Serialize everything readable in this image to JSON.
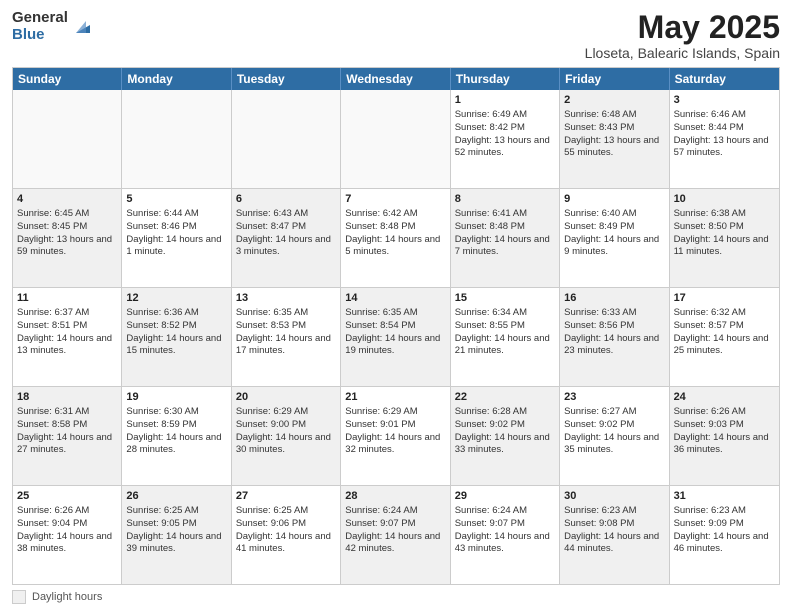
{
  "logo": {
    "general": "General",
    "blue": "Blue",
    "icon_color": "#2e6da4"
  },
  "title": "May 2025",
  "location": "Lloseta, Balearic Islands, Spain",
  "days_of_week": [
    "Sunday",
    "Monday",
    "Tuesday",
    "Wednesday",
    "Thursday",
    "Friday",
    "Saturday"
  ],
  "weeks": [
    [
      {
        "day": "",
        "sunrise": "",
        "sunset": "",
        "daylight": "",
        "shaded": false,
        "empty": true
      },
      {
        "day": "",
        "sunrise": "",
        "sunset": "",
        "daylight": "",
        "shaded": false,
        "empty": true
      },
      {
        "day": "",
        "sunrise": "",
        "sunset": "",
        "daylight": "",
        "shaded": false,
        "empty": true
      },
      {
        "day": "",
        "sunrise": "",
        "sunset": "",
        "daylight": "",
        "shaded": false,
        "empty": true
      },
      {
        "day": "1",
        "sunrise": "Sunrise: 6:49 AM",
        "sunset": "Sunset: 8:42 PM",
        "daylight": "Daylight: 13 hours and 52 minutes.",
        "shaded": false,
        "empty": false
      },
      {
        "day": "2",
        "sunrise": "Sunrise: 6:48 AM",
        "sunset": "Sunset: 8:43 PM",
        "daylight": "Daylight: 13 hours and 55 minutes.",
        "shaded": true,
        "empty": false
      },
      {
        "day": "3",
        "sunrise": "Sunrise: 6:46 AM",
        "sunset": "Sunset: 8:44 PM",
        "daylight": "Daylight: 13 hours and 57 minutes.",
        "shaded": false,
        "empty": false
      }
    ],
    [
      {
        "day": "4",
        "sunrise": "Sunrise: 6:45 AM",
        "sunset": "Sunset: 8:45 PM",
        "daylight": "Daylight: 13 hours and 59 minutes.",
        "shaded": true,
        "empty": false
      },
      {
        "day": "5",
        "sunrise": "Sunrise: 6:44 AM",
        "sunset": "Sunset: 8:46 PM",
        "daylight": "Daylight: 14 hours and 1 minute.",
        "shaded": false,
        "empty": false
      },
      {
        "day": "6",
        "sunrise": "Sunrise: 6:43 AM",
        "sunset": "Sunset: 8:47 PM",
        "daylight": "Daylight: 14 hours and 3 minutes.",
        "shaded": true,
        "empty": false
      },
      {
        "day": "7",
        "sunrise": "Sunrise: 6:42 AM",
        "sunset": "Sunset: 8:48 PM",
        "daylight": "Daylight: 14 hours and 5 minutes.",
        "shaded": false,
        "empty": false
      },
      {
        "day": "8",
        "sunrise": "Sunrise: 6:41 AM",
        "sunset": "Sunset: 8:48 PM",
        "daylight": "Daylight: 14 hours and 7 minutes.",
        "shaded": true,
        "empty": false
      },
      {
        "day": "9",
        "sunrise": "Sunrise: 6:40 AM",
        "sunset": "Sunset: 8:49 PM",
        "daylight": "Daylight: 14 hours and 9 minutes.",
        "shaded": false,
        "empty": false
      },
      {
        "day": "10",
        "sunrise": "Sunrise: 6:38 AM",
        "sunset": "Sunset: 8:50 PM",
        "daylight": "Daylight: 14 hours and 11 minutes.",
        "shaded": true,
        "empty": false
      }
    ],
    [
      {
        "day": "11",
        "sunrise": "Sunrise: 6:37 AM",
        "sunset": "Sunset: 8:51 PM",
        "daylight": "Daylight: 14 hours and 13 minutes.",
        "shaded": false,
        "empty": false
      },
      {
        "day": "12",
        "sunrise": "Sunrise: 6:36 AM",
        "sunset": "Sunset: 8:52 PM",
        "daylight": "Daylight: 14 hours and 15 minutes.",
        "shaded": true,
        "empty": false
      },
      {
        "day": "13",
        "sunrise": "Sunrise: 6:35 AM",
        "sunset": "Sunset: 8:53 PM",
        "daylight": "Daylight: 14 hours and 17 minutes.",
        "shaded": false,
        "empty": false
      },
      {
        "day": "14",
        "sunrise": "Sunrise: 6:35 AM",
        "sunset": "Sunset: 8:54 PM",
        "daylight": "Daylight: 14 hours and 19 minutes.",
        "shaded": true,
        "empty": false
      },
      {
        "day": "15",
        "sunrise": "Sunrise: 6:34 AM",
        "sunset": "Sunset: 8:55 PM",
        "daylight": "Daylight: 14 hours and 21 minutes.",
        "shaded": false,
        "empty": false
      },
      {
        "day": "16",
        "sunrise": "Sunrise: 6:33 AM",
        "sunset": "Sunset: 8:56 PM",
        "daylight": "Daylight: 14 hours and 23 minutes.",
        "shaded": true,
        "empty": false
      },
      {
        "day": "17",
        "sunrise": "Sunrise: 6:32 AM",
        "sunset": "Sunset: 8:57 PM",
        "daylight": "Daylight: 14 hours and 25 minutes.",
        "shaded": false,
        "empty": false
      }
    ],
    [
      {
        "day": "18",
        "sunrise": "Sunrise: 6:31 AM",
        "sunset": "Sunset: 8:58 PM",
        "daylight": "Daylight: 14 hours and 27 minutes.",
        "shaded": true,
        "empty": false
      },
      {
        "day": "19",
        "sunrise": "Sunrise: 6:30 AM",
        "sunset": "Sunset: 8:59 PM",
        "daylight": "Daylight: 14 hours and 28 minutes.",
        "shaded": false,
        "empty": false
      },
      {
        "day": "20",
        "sunrise": "Sunrise: 6:29 AM",
        "sunset": "Sunset: 9:00 PM",
        "daylight": "Daylight: 14 hours and 30 minutes.",
        "shaded": true,
        "empty": false
      },
      {
        "day": "21",
        "sunrise": "Sunrise: 6:29 AM",
        "sunset": "Sunset: 9:01 PM",
        "daylight": "Daylight: 14 hours and 32 minutes.",
        "shaded": false,
        "empty": false
      },
      {
        "day": "22",
        "sunrise": "Sunrise: 6:28 AM",
        "sunset": "Sunset: 9:02 PM",
        "daylight": "Daylight: 14 hours and 33 minutes.",
        "shaded": true,
        "empty": false
      },
      {
        "day": "23",
        "sunrise": "Sunrise: 6:27 AM",
        "sunset": "Sunset: 9:02 PM",
        "daylight": "Daylight: 14 hours and 35 minutes.",
        "shaded": false,
        "empty": false
      },
      {
        "day": "24",
        "sunrise": "Sunrise: 6:26 AM",
        "sunset": "Sunset: 9:03 PM",
        "daylight": "Daylight: 14 hours and 36 minutes.",
        "shaded": true,
        "empty": false
      }
    ],
    [
      {
        "day": "25",
        "sunrise": "Sunrise: 6:26 AM",
        "sunset": "Sunset: 9:04 PM",
        "daylight": "Daylight: 14 hours and 38 minutes.",
        "shaded": false,
        "empty": false
      },
      {
        "day": "26",
        "sunrise": "Sunrise: 6:25 AM",
        "sunset": "Sunset: 9:05 PM",
        "daylight": "Daylight: 14 hours and 39 minutes.",
        "shaded": true,
        "empty": false
      },
      {
        "day": "27",
        "sunrise": "Sunrise: 6:25 AM",
        "sunset": "Sunset: 9:06 PM",
        "daylight": "Daylight: 14 hours and 41 minutes.",
        "shaded": false,
        "empty": false
      },
      {
        "day": "28",
        "sunrise": "Sunrise: 6:24 AM",
        "sunset": "Sunset: 9:07 PM",
        "daylight": "Daylight: 14 hours and 42 minutes.",
        "shaded": true,
        "empty": false
      },
      {
        "day": "29",
        "sunrise": "Sunrise: 6:24 AM",
        "sunset": "Sunset: 9:07 PM",
        "daylight": "Daylight: 14 hours and 43 minutes.",
        "shaded": false,
        "empty": false
      },
      {
        "day": "30",
        "sunrise": "Sunrise: 6:23 AM",
        "sunset": "Sunset: 9:08 PM",
        "daylight": "Daylight: 14 hours and 44 minutes.",
        "shaded": true,
        "empty": false
      },
      {
        "day": "31",
        "sunrise": "Sunrise: 6:23 AM",
        "sunset": "Sunset: 9:09 PM",
        "daylight": "Daylight: 14 hours and 46 minutes.",
        "shaded": false,
        "empty": false
      }
    ]
  ],
  "footer": {
    "box_label": "Daylight hours"
  }
}
